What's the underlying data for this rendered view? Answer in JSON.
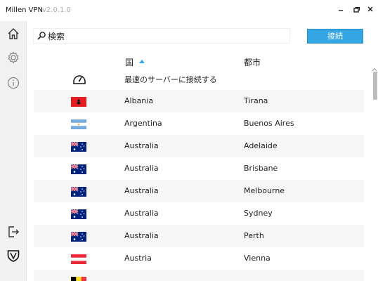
{
  "window": {
    "title": "Millen VPN",
    "version": "v2.0.1.0",
    "minimize": "−",
    "maximize": "▣",
    "close": "✕"
  },
  "sidebar": {
    "items": [
      {
        "icon": "home-icon"
      },
      {
        "icon": "gear-icon"
      },
      {
        "icon": "info-icon"
      },
      {
        "icon": "logout-icon"
      },
      {
        "icon": "shield-icon"
      }
    ]
  },
  "search": {
    "value": "検索"
  },
  "connect_button": "接続",
  "columns": {
    "country": "国",
    "city": "都市",
    "sort": "ascending"
  },
  "fastest": {
    "label": "最速のサーバーに接続する",
    "icon": "speedometer-icon"
  },
  "servers": [
    {
      "country": "Albania",
      "city": "Tirana",
      "flag": "albania-flag"
    },
    {
      "country": "Argentina",
      "city": "Buenos Aires",
      "flag": "argentina-flag"
    },
    {
      "country": "Australia",
      "city": "Adelaide",
      "flag": "australia-flag"
    },
    {
      "country": "Australia",
      "city": "Brisbane",
      "flag": "australia-flag"
    },
    {
      "country": "Australia",
      "city": "Melbourne",
      "flag": "australia-flag"
    },
    {
      "country": "Australia",
      "city": "Sydney",
      "flag": "australia-flag"
    },
    {
      "country": "Australia",
      "city": "Perth",
      "flag": "australia-flag"
    },
    {
      "country": "Austria",
      "city": "Vienna",
      "flag": "austria-flag"
    },
    {
      "country": "",
      "city": "",
      "flag": "belgium-flag"
    }
  ],
  "colors": {
    "accent": "#33a6e3",
    "sidebar_bg": "#f1f1f1",
    "row_alt": "#f6f6f6"
  }
}
